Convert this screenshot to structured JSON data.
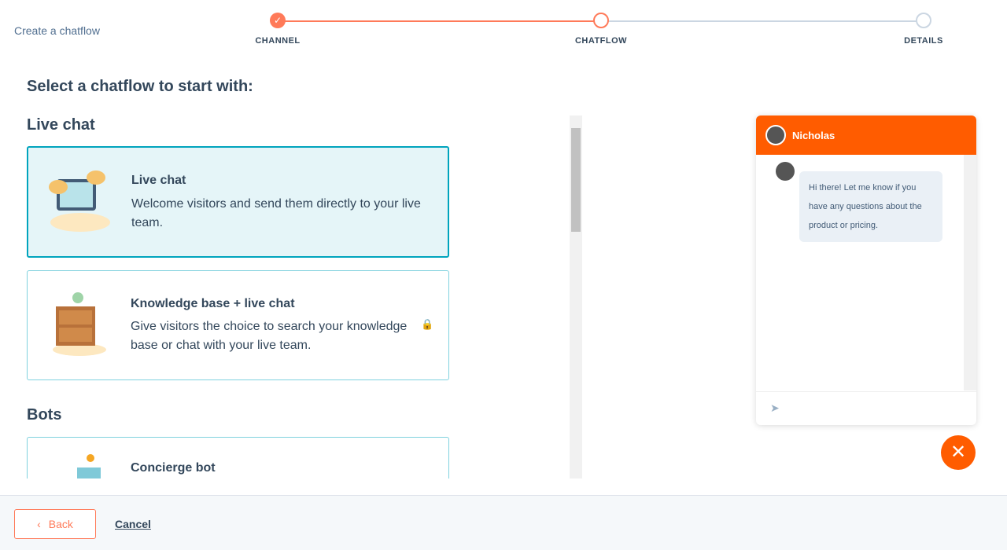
{
  "header": {
    "breadcrumb": "Create a chatflow",
    "steps": [
      {
        "label": "CHANNEL",
        "state": "complete"
      },
      {
        "label": "CHATFLOW",
        "state": "current"
      },
      {
        "label": "DETAILS",
        "state": "upcoming"
      }
    ]
  },
  "main": {
    "title": "Select a chatflow to start with:",
    "sections": [
      {
        "title": "Live chat"
      },
      {
        "title": "Bots"
      }
    ],
    "cards": [
      {
        "title": "Live chat",
        "description": "Welcome visitors and send them directly to your live team.",
        "selected": true,
        "icon": "laptop-chat-illustration"
      },
      {
        "title": "Knowledge base + live chat",
        "description": "Give visitors the choice to search your knowledge base or chat with your live team.",
        "locked": true,
        "icon": "cabinet-illustration"
      },
      {
        "title": "Concierge bot",
        "icon": "mailbox-illustration"
      }
    ]
  },
  "preview": {
    "agent_name": "Nicholas",
    "message": "Hi there! Let me know if you have any questions about the product or pricing.",
    "send_icon": "paper-plane-icon",
    "close_icon": "close-icon",
    "accent": "#ff5c00"
  },
  "footer": {
    "back_label": "Back",
    "cancel_label": "Cancel"
  }
}
